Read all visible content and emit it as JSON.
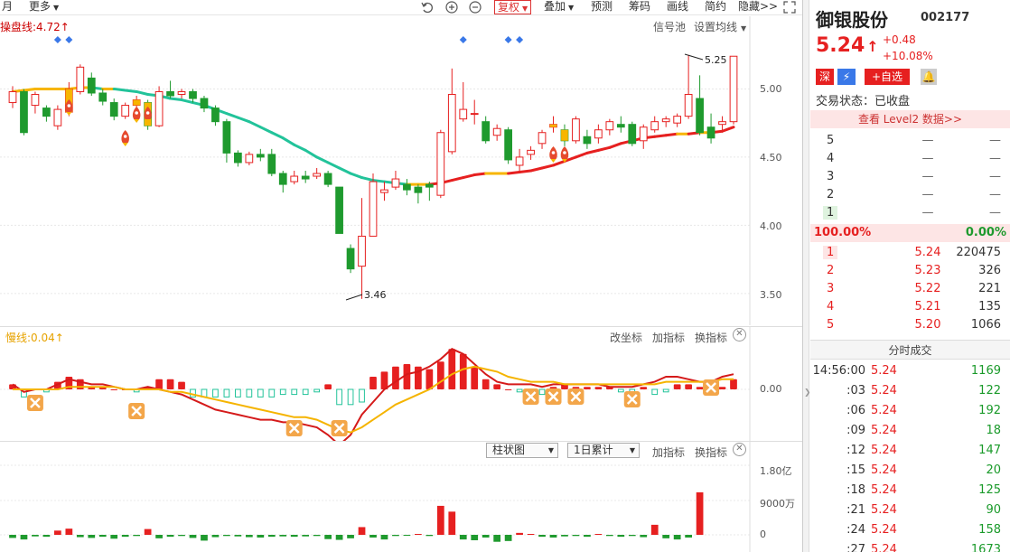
{
  "toolbar": {
    "month_label": "月",
    "more_label": "更多",
    "fuquan_label": "复权",
    "diejia_label": "叠加",
    "yuce_label": "预测",
    "chouma_label": "筹码",
    "huaxian_label": "画线",
    "jianyue_label": "简约",
    "yincang_label": "隐藏>>"
  },
  "main_chart": {
    "indicator_label": "操盘线:4.72↑",
    "signal_pool_label": "信号池",
    "set_ma_label": "设置均线",
    "high_annotation": "5.25",
    "low_annotation": "3.46",
    "y_ticks": [
      "5.00",
      "4.50",
      "4.00",
      "3.50"
    ]
  },
  "macd_panel": {
    "label": "慢线:0.04↑",
    "change_coord_label": "改坐标",
    "add_indicator_label": "加指标",
    "switch_indicator_label": "换指标",
    "zero_label": "0.00"
  },
  "volume_panel": {
    "chart_type_label": "柱状图",
    "accum_label": "1日累计",
    "add_indicator_label": "加指标",
    "switch_indicator_label": "换指标",
    "y_ticks": [
      "1.80亿",
      "9000万",
      "0"
    ]
  },
  "chart_data": {
    "type": "candlestick",
    "y_range": [
      3.3,
      5.5
    ],
    "candles": [
      {
        "o": 4.9,
        "c": 4.98,
        "h": 5.02,
        "l": 4.86
      },
      {
        "o": 4.98,
        "c": 4.68,
        "h": 5.0,
        "l": 4.66
      },
      {
        "o": 4.88,
        "c": 4.96,
        "h": 4.98,
        "l": 4.82
      },
      {
        "o": 4.86,
        "c": 4.8,
        "h": 4.88,
        "l": 4.76
      },
      {
        "o": 4.73,
        "c": 4.85,
        "h": 4.88,
        "l": 4.7
      },
      {
        "o": 4.83,
        "c": 5.0,
        "h": 5.05,
        "l": 4.8
      },
      {
        "o": 4.98,
        "c": 5.16,
        "h": 5.18,
        "l": 4.96
      },
      {
        "o": 5.08,
        "c": 4.97,
        "h": 5.12,
        "l": 4.95
      },
      {
        "o": 4.97,
        "c": 4.91,
        "h": 5.0,
        "l": 4.88
      },
      {
        "o": 4.9,
        "c": 4.8,
        "h": 4.93,
        "l": 4.77
      },
      {
        "o": 4.8,
        "c": 4.88,
        "h": 4.9,
        "l": 4.78
      },
      {
        "o": 4.88,
        "c": 4.92,
        "h": 4.95,
        "l": 4.86
      },
      {
        "o": 4.9,
        "c": 4.73,
        "h": 4.92,
        "l": 4.7
      },
      {
        "o": 4.73,
        "c": 4.98,
        "h": 5.02,
        "l": 4.72
      },
      {
        "o": 4.98,
        "c": 4.95,
        "h": 5.06,
        "l": 4.93
      },
      {
        "o": 4.96,
        "c": 4.98,
        "h": 5.0,
        "l": 4.93
      },
      {
        "o": 4.98,
        "c": 4.93,
        "h": 5.0,
        "l": 4.9
      },
      {
        "o": 4.93,
        "c": 4.86,
        "h": 4.95,
        "l": 4.83
      },
      {
        "o": 4.86,
        "c": 4.76,
        "h": 4.88,
        "l": 4.73
      },
      {
        "o": 4.76,
        "c": 4.53,
        "h": 4.78,
        "l": 4.46
      },
      {
        "o": 4.53,
        "c": 4.46,
        "h": 4.55,
        "l": 4.43
      },
      {
        "o": 4.46,
        "c": 4.52,
        "h": 4.54,
        "l": 4.44
      },
      {
        "o": 4.52,
        "c": 4.5,
        "h": 4.56,
        "l": 4.47
      },
      {
        "o": 4.52,
        "c": 4.38,
        "h": 4.56,
        "l": 4.36
      },
      {
        "o": 4.38,
        "c": 4.3,
        "h": 4.4,
        "l": 4.24
      },
      {
        "o": 4.32,
        "c": 4.36,
        "h": 4.4,
        "l": 4.3
      },
      {
        "o": 4.36,
        "c": 4.34,
        "h": 4.4,
        "l": 4.31
      },
      {
        "o": 4.36,
        "c": 4.38,
        "h": 4.42,
        "l": 4.34
      },
      {
        "o": 4.38,
        "c": 4.3,
        "h": 4.4,
        "l": 4.28
      },
      {
        "o": 4.28,
        "c": 3.94,
        "h": 4.28,
        "l": 3.94
      },
      {
        "o": 3.83,
        "c": 3.68,
        "h": 3.86,
        "l": 3.65
      },
      {
        "o": 3.7,
        "c": 3.92,
        "h": 4.2,
        "l": 3.46
      },
      {
        "o": 3.92,
        "c": 4.32,
        "h": 4.38,
        "l": 3.92
      },
      {
        "o": 4.24,
        "c": 4.26,
        "h": 4.32,
        "l": 4.18
      },
      {
        "o": 4.28,
        "c": 4.34,
        "h": 4.4,
        "l": 4.26
      },
      {
        "o": 4.3,
        "c": 4.26,
        "h": 4.34,
        "l": 4.22
      },
      {
        "o": 4.28,
        "c": 4.24,
        "h": 4.3,
        "l": 4.16
      },
      {
        "o": 4.3,
        "c": 4.28,
        "h": 4.32,
        "l": 4.18
      },
      {
        "o": 4.22,
        "c": 4.68,
        "h": 4.7,
        "l": 4.2
      },
      {
        "o": 4.54,
        "c": 4.96,
        "h": 5.15,
        "l": 4.52
      },
      {
        "o": 4.78,
        "c": 4.85,
        "h": 5.05,
        "l": 4.76
      },
      {
        "o": 4.82,
        "c": 4.82,
        "h": 4.92,
        "l": 4.74
      },
      {
        "o": 4.76,
        "c": 4.62,
        "h": 4.8,
        "l": 4.6
      },
      {
        "o": 4.66,
        "c": 4.71,
        "h": 4.74,
        "l": 4.62
      },
      {
        "o": 4.7,
        "c": 4.48,
        "h": 4.72,
        "l": 4.45
      },
      {
        "o": 4.44,
        "c": 4.5,
        "h": 4.56,
        "l": 4.4
      },
      {
        "o": 4.52,
        "c": 4.55,
        "h": 4.58,
        "l": 4.48
      },
      {
        "o": 4.6,
        "c": 4.68,
        "h": 4.7,
        "l": 4.56
      },
      {
        "o": 4.72,
        "c": 4.74,
        "h": 4.8,
        "l": 4.68
      },
      {
        "o": 4.7,
        "c": 4.62,
        "h": 4.74,
        "l": 4.58
      },
      {
        "o": 4.62,
        "c": 4.78,
        "h": 4.8,
        "l": 4.6
      },
      {
        "o": 4.65,
        "c": 4.6,
        "h": 4.7,
        "l": 4.56
      },
      {
        "o": 4.64,
        "c": 4.7,
        "h": 4.74,
        "l": 4.6
      },
      {
        "o": 4.7,
        "c": 4.76,
        "h": 4.78,
        "l": 4.66
      },
      {
        "o": 4.74,
        "c": 4.72,
        "h": 4.8,
        "l": 4.68
      },
      {
        "o": 4.74,
        "c": 4.6,
        "h": 4.76,
        "l": 4.58
      },
      {
        "o": 4.62,
        "c": 4.72,
        "h": 4.74,
        "l": 4.56
      },
      {
        "o": 4.7,
        "c": 4.76,
        "h": 4.8,
        "l": 4.68
      },
      {
        "o": 4.76,
        "c": 4.78,
        "h": 4.8,
        "l": 4.72
      },
      {
        "o": 4.75,
        "c": 4.8,
        "h": 4.82,
        "l": 4.72
      },
      {
        "o": 4.8,
        "c": 4.96,
        "h": 5.25,
        "l": 4.78
      },
      {
        "o": 4.93,
        "c": 4.68,
        "h": 5.1,
        "l": 4.66
      },
      {
        "o": 4.72,
        "c": 4.64,
        "h": 4.82,
        "l": 4.6
      },
      {
        "o": 4.74,
        "c": 4.76,
        "h": 4.8,
        "l": 4.68
      },
      {
        "o": 4.76,
        "c": 5.24,
        "h": 5.24,
        "l": 4.74
      }
    ],
    "caopan_line": [
      4.98,
      4.99,
      5.0,
      5.0,
      5.0,
      5.0,
      5.01,
      5.01,
      5.0,
      5.0,
      4.99,
      4.98,
      4.96,
      4.95,
      4.93,
      4.92,
      4.9,
      4.88,
      4.85,
      4.82,
      4.79,
      4.76,
      4.72,
      4.68,
      4.64,
      4.59,
      4.55,
      4.5,
      4.46,
      4.42,
      4.38,
      4.35,
      4.33,
      4.32,
      4.31,
      4.3,
      4.3,
      4.3,
      4.31,
      4.33,
      4.35,
      4.37,
      4.38,
      4.38,
      4.38,
      4.39,
      4.4,
      4.42,
      4.44,
      4.47,
      4.5,
      4.53,
      4.55,
      4.57,
      4.6,
      4.62,
      4.64,
      4.65,
      4.66,
      4.67,
      4.67,
      4.68,
      4.68,
      4.69,
      4.72
    ],
    "macd_fast": [
      0.02,
      -0.01,
      0.0,
      0.0,
      0.02,
      0.04,
      0.03,
      0.02,
      0.02,
      0.01,
      0.0,
      0.0,
      0.01,
      0.0,
      -0.01,
      -0.02,
      -0.04,
      -0.06,
      -0.08,
      -0.09,
      -0.1,
      -0.11,
      -0.12,
      -0.12,
      -0.13,
      -0.13,
      -0.14,
      -0.15,
      -0.18,
      -0.22,
      -0.18,
      -0.1,
      -0.05,
      0.0,
      0.03,
      0.06,
      0.07,
      0.09,
      0.12,
      0.16,
      0.14,
      0.1,
      0.06,
      0.03,
      0.02,
      0.02,
      0.02,
      0.01,
      0.02,
      0.02,
      0.02,
      0.02,
      0.02,
      0.01,
      0.01,
      0.01,
      0.02,
      0.03,
      0.05,
      0.05,
      0.04,
      0.03,
      0.03,
      0.05,
      0.06
    ],
    "macd_slow": [
      0.0,
      0.0,
      0.0,
      0.0,
      0.0,
      0.01,
      0.01,
      0.01,
      0.01,
      0.01,
      0.0,
      0.0,
      0.0,
      0.0,
      -0.01,
      -0.01,
      -0.02,
      -0.03,
      -0.04,
      -0.05,
      -0.06,
      -0.07,
      -0.08,
      -0.09,
      -0.1,
      -0.11,
      -0.11,
      -0.12,
      -0.14,
      -0.16,
      -0.17,
      -0.15,
      -0.12,
      -0.09,
      -0.06,
      -0.04,
      -0.02,
      0.0,
      0.03,
      0.06,
      0.08,
      0.09,
      0.08,
      0.07,
      0.05,
      0.04,
      0.03,
      0.03,
      0.03,
      0.02,
      0.02,
      0.02,
      0.02,
      0.02,
      0.02,
      0.02,
      0.02,
      0.02,
      0.03,
      0.03,
      0.03,
      0.03,
      0.03,
      0.04,
      0.04
    ],
    "macd_hist": [
      0.02,
      -0.03,
      0.0,
      -0.01,
      0.03,
      0.05,
      0.04,
      0.01,
      0.01,
      0.0,
      0.0,
      -0.01,
      0.01,
      0.04,
      0.04,
      0.03,
      -0.03,
      -0.03,
      -0.03,
      -0.03,
      -0.03,
      -0.03,
      -0.03,
      -0.03,
      -0.02,
      -0.02,
      -0.02,
      -0.01,
      0.02,
      -0.06,
      -0.06,
      -0.05,
      0.05,
      0.07,
      0.09,
      0.1,
      0.09,
      0.08,
      0.11,
      0.16,
      0.14,
      0.09,
      0.04,
      0.02,
      0.0,
      -0.01,
      -0.01,
      -0.02,
      0.01,
      0.02,
      0.01,
      0.01,
      0.01,
      0.01,
      -0.01,
      -0.01,
      0.01,
      -0.02,
      -0.01,
      0.02,
      0.02,
      0.01,
      -0.01,
      0.01,
      0.04
    ],
    "volume_wan": [
      -800,
      -1200,
      -400,
      -500,
      1100,
      1600,
      -600,
      -800,
      -500,
      -1000,
      -500,
      -300,
      1500,
      -900,
      -500,
      -300,
      -800,
      -1500,
      -600,
      -300,
      -400,
      -600,
      -700,
      -500,
      -400,
      -500,
      -400,
      -300,
      -1100,
      -1300,
      -900,
      2000,
      -700,
      -1200,
      -300,
      -200,
      200,
      -300,
      7500,
      6000,
      -1200,
      -1400,
      -700,
      -1800,
      -1600,
      500,
      200,
      -500,
      -700,
      -400,
      -300,
      -500,
      200,
      -300,
      -500,
      -300,
      -600,
      2600,
      -900,
      -1200,
      -700,
      11000
    ]
  },
  "stock": {
    "name": "御银股份",
    "code": "002177",
    "price": "5.24",
    "price_arrow": "↑",
    "change": "+0.48",
    "change_pct": "+10.08%",
    "badge_exchange": "深",
    "badge_add": "+自选",
    "trade_status": "交易状态：已收盘",
    "level2_link": "查看 Level2 数据>>"
  },
  "orderbook": {
    "asks": [
      {
        "level": "5",
        "price": "—",
        "volume": "—"
      },
      {
        "level": "4",
        "price": "—",
        "volume": "—"
      },
      {
        "level": "3",
        "price": "—",
        "volume": "—"
      },
      {
        "level": "2",
        "price": "—",
        "volume": "—"
      },
      {
        "level": "1",
        "price": "—",
        "volume": "—"
      }
    ],
    "ratio_left": "100.00%",
    "ratio_right": "0.00%",
    "bids": [
      {
        "level": "1",
        "price": "5.24",
        "volume": "220475"
      },
      {
        "level": "2",
        "price": "5.23",
        "volume": "326"
      },
      {
        "level": "3",
        "price": "5.22",
        "volume": "221"
      },
      {
        "level": "4",
        "price": "5.21",
        "volume": "135"
      },
      {
        "level": "5",
        "price": "5.20",
        "volume": "1066"
      }
    ]
  },
  "ticks": {
    "title": "分时成交",
    "rows": [
      {
        "time": "14:56:00",
        "price": "5.24",
        "volume": "1169"
      },
      {
        "time": ":03",
        "price": "5.24",
        "volume": "122"
      },
      {
        "time": ":06",
        "price": "5.24",
        "volume": "192"
      },
      {
        "time": ":09",
        "price": "5.24",
        "volume": "18"
      },
      {
        "time": ":12",
        "price": "5.24",
        "volume": "147"
      },
      {
        "time": ":15",
        "price": "5.24",
        "volume": "20"
      },
      {
        "time": ":18",
        "price": "5.24",
        "volume": "125"
      },
      {
        "time": ":21",
        "price": "5.24",
        "volume": "90"
      },
      {
        "time": ":24",
        "price": "5.24",
        "volume": "158"
      },
      {
        "time": ":27",
        "price": "5.24",
        "volume": "1673"
      }
    ]
  },
  "colors": {
    "up": "#e62020",
    "down": "#1f9a2e",
    "gold": "#f7b500",
    "accent": "#3a78e8",
    "ma_green": "#22c39a"
  }
}
